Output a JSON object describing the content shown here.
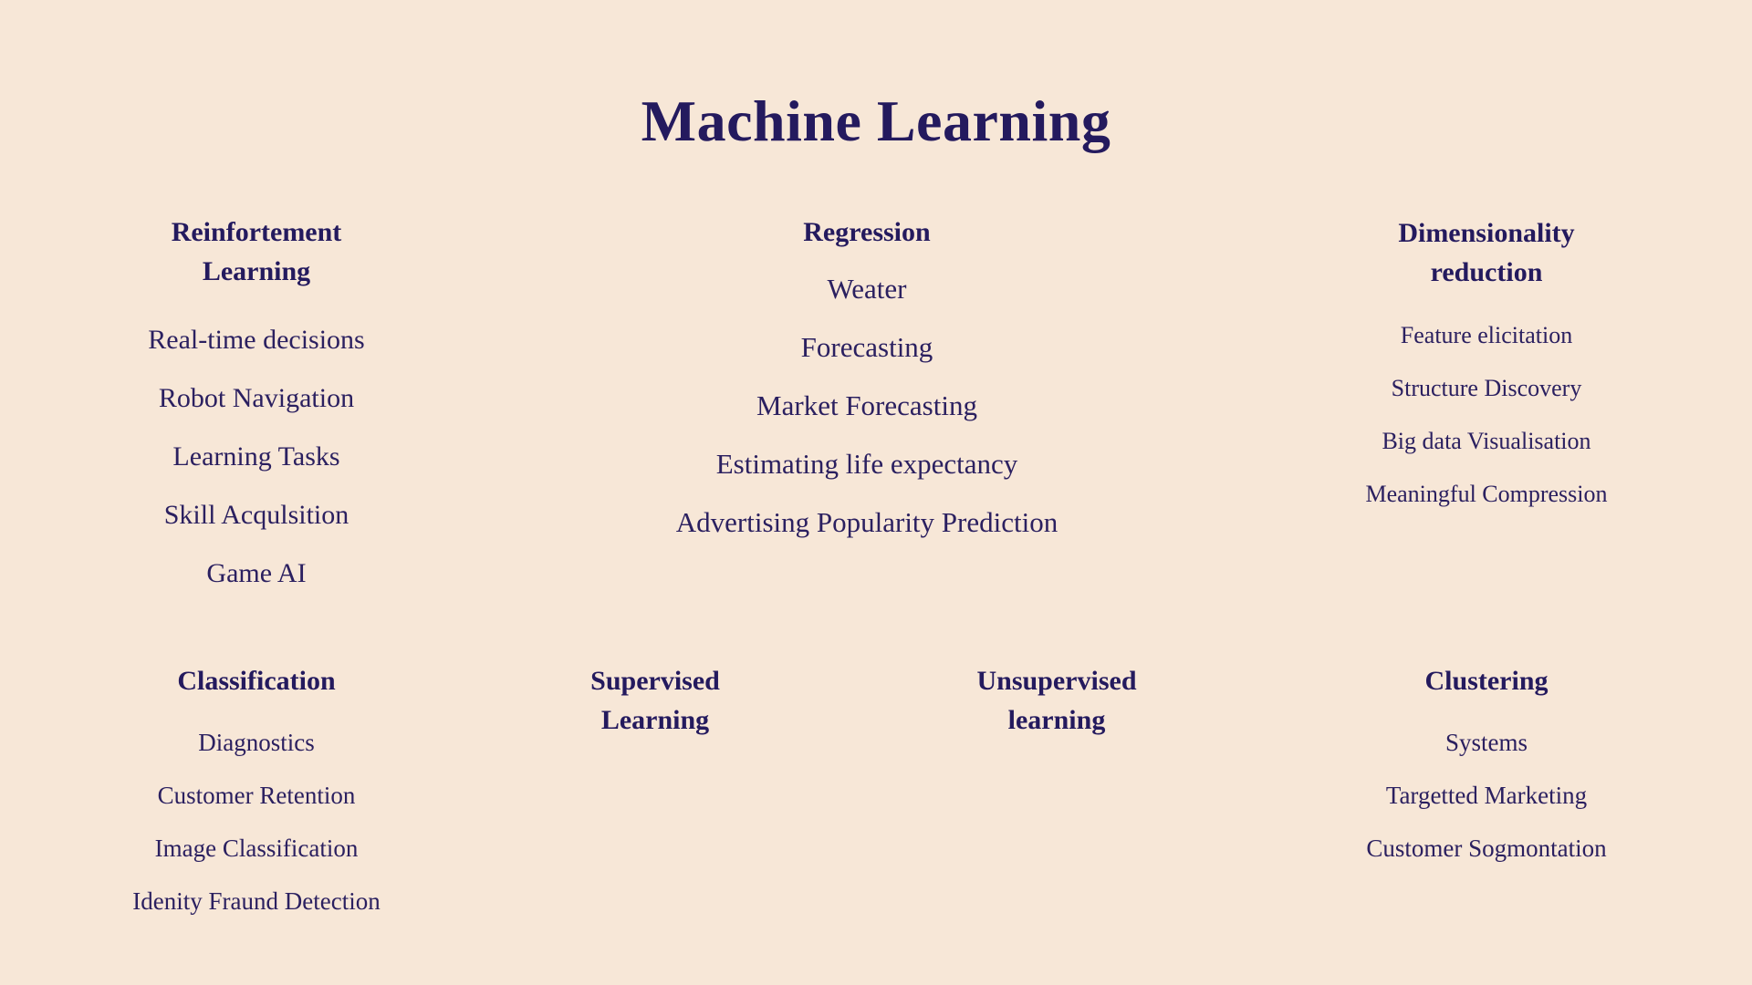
{
  "theme": {
    "background": "#f7e7d7",
    "text": "#241a5e"
  },
  "title": "Machine Learning",
  "columns": {
    "reinforcement": {
      "heading": "Reinfortement Learning",
      "items": [
        "Real-time decisions",
        "Robot Navigation",
        "Learning Tasks",
        "Skill Acqulsition",
        "Game AI"
      ]
    },
    "regression": {
      "heading": "Regression",
      "items": [
        "Weater",
        "Forecasting",
        "Market Forecasting",
        "Estimating life expectancy",
        "Advertising Popularity Prediction"
      ]
    },
    "dimensionality": {
      "heading": "Dimensionality reduction",
      "items": [
        "Feature elicitation",
        "Structure Discovery",
        "Big data Visualisation",
        "Meaningful Compression"
      ]
    },
    "classification": {
      "heading": "Classification",
      "items": [
        "Diagnostics",
        "Customer Retention",
        "Image Classification",
        "Idenity Fraund Detection"
      ]
    },
    "supervised": {
      "heading": "Supervised Learning",
      "items": []
    },
    "unsupervised": {
      "heading": "Unsupervised learning",
      "items": []
    },
    "clustering": {
      "heading": "Clustering",
      "items": [
        "Systems",
        "Targetted Marketing",
        "Customer Sogmontation"
      ]
    }
  }
}
